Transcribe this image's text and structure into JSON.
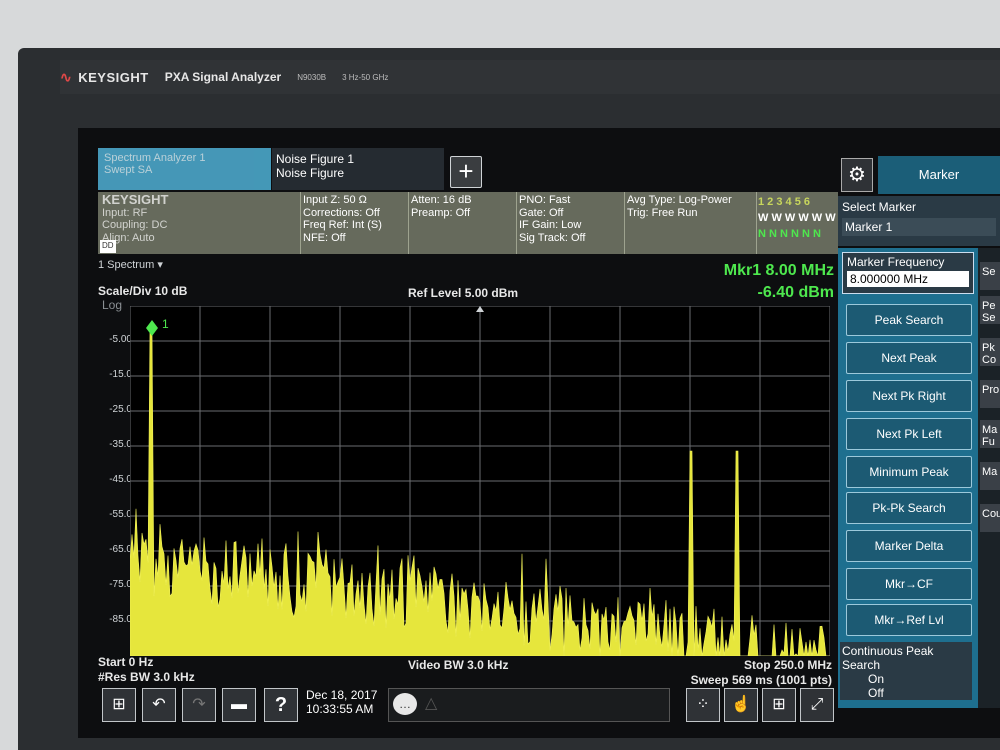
{
  "brand": {
    "company": "KEYSIGHT",
    "model": "PXA Signal Analyzer",
    "model_no": "N9030B",
    "range": "3 Hz-50 GHz"
  },
  "tabs": [
    {
      "line1": "Spectrum Analyzer 1",
      "line2": "Swept SA"
    },
    {
      "line1": "Noise Figure 1",
      "line2": "Noise Figure"
    }
  ],
  "add_button": "+",
  "marker_tab": "Marker",
  "info": {
    "brand_small": "KEYSIGHT",
    "input": "Input: RF",
    "coupling": "Coupling: DC",
    "align": "Align: Auto",
    "small_tag": "DD",
    "col2": [
      "Input Z: 50 Ω",
      "Corrections: Off",
      "Freq Ref: Int (S)",
      "NFE: Off"
    ],
    "col3": [
      "Atten: 16 dB",
      "Preamp: Off"
    ],
    "col4": [
      "PNO: Fast",
      "Gate: Off",
      "IF Gain: Low",
      "Sig Track: Off"
    ],
    "col5": [
      "Avg Type: Log-Power",
      "Trig: Free Run"
    ],
    "trace_numbers": "1 2 3 4 5 6",
    "trace_types": "W W W W W W",
    "trace_detect": "N N N N N N"
  },
  "select_marker": {
    "label": "Select Marker",
    "value": "Marker 1"
  },
  "plot": {
    "window": "1 Spectrum",
    "scale": "Scale/Div 10 dB",
    "log": "Log",
    "ref_level": "Ref Level 5.00 dBm",
    "mkr_freq": "Mkr1  8.00 MHz",
    "mkr_amp": "-6.40 dBm",
    "yticks": [
      "-5.00",
      "-15.0",
      "-25.0",
      "-35.0",
      "-45.0",
      "-55.0",
      "-65.0",
      "-75.0",
      "-85.0"
    ],
    "start": "Start 0 Hz",
    "res_bw": "#Res BW 3.0 kHz",
    "video_bw": "Video BW 3.0 kHz",
    "stop": "Stop 250.0 MHz",
    "sweep": "Sweep 569 ms (1001 pts)",
    "marker_label": "1"
  },
  "toolbar": {
    "date": "Dec 18, 2017",
    "time": "10:33:55 AM"
  },
  "marker_panel": {
    "freq_label": "Marker Frequency",
    "freq_value": "8.000000 MHz",
    "buttons": [
      "Peak Search",
      "Next Peak",
      "Next Pk Right",
      "Next Pk Left",
      "Minimum Peak",
      "Pk-Pk Search",
      "Marker Delta",
      "Mkr→CF",
      "Mkr→Ref Lvl"
    ],
    "continuous": "Continuous Peak Search",
    "on": "On",
    "off": "Off"
  },
  "right_col": [
    "Se",
    "Pe Se",
    "Pk Co",
    "Pro",
    "Ma Fu",
    "Ma",
    "Cou"
  ],
  "colors": {
    "trace": "#e6e63c",
    "marker": "#4ee84e",
    "panel": "#1e6f8f"
  }
}
